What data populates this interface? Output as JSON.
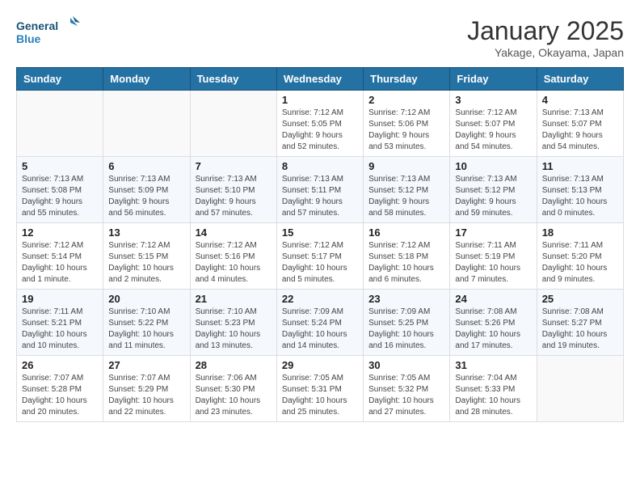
{
  "logo": {
    "line1": "General",
    "line2": "Blue"
  },
  "title": "January 2025",
  "subtitle": "Yakage, Okayama, Japan",
  "weekdays": [
    "Sunday",
    "Monday",
    "Tuesday",
    "Wednesday",
    "Thursday",
    "Friday",
    "Saturday"
  ],
  "weeks": [
    [
      {
        "day": "",
        "info": ""
      },
      {
        "day": "",
        "info": ""
      },
      {
        "day": "",
        "info": ""
      },
      {
        "day": "1",
        "info": "Sunrise: 7:12 AM\nSunset: 5:05 PM\nDaylight: 9 hours and 52 minutes."
      },
      {
        "day": "2",
        "info": "Sunrise: 7:12 AM\nSunset: 5:06 PM\nDaylight: 9 hours and 53 minutes."
      },
      {
        "day": "3",
        "info": "Sunrise: 7:12 AM\nSunset: 5:07 PM\nDaylight: 9 hours and 54 minutes."
      },
      {
        "day": "4",
        "info": "Sunrise: 7:13 AM\nSunset: 5:07 PM\nDaylight: 9 hours and 54 minutes."
      }
    ],
    [
      {
        "day": "5",
        "info": "Sunrise: 7:13 AM\nSunset: 5:08 PM\nDaylight: 9 hours and 55 minutes."
      },
      {
        "day": "6",
        "info": "Sunrise: 7:13 AM\nSunset: 5:09 PM\nDaylight: 9 hours and 56 minutes."
      },
      {
        "day": "7",
        "info": "Sunrise: 7:13 AM\nSunset: 5:10 PM\nDaylight: 9 hours and 57 minutes."
      },
      {
        "day": "8",
        "info": "Sunrise: 7:13 AM\nSunset: 5:11 PM\nDaylight: 9 hours and 57 minutes."
      },
      {
        "day": "9",
        "info": "Sunrise: 7:13 AM\nSunset: 5:12 PM\nDaylight: 9 hours and 58 minutes."
      },
      {
        "day": "10",
        "info": "Sunrise: 7:13 AM\nSunset: 5:12 PM\nDaylight: 9 hours and 59 minutes."
      },
      {
        "day": "11",
        "info": "Sunrise: 7:13 AM\nSunset: 5:13 PM\nDaylight: 10 hours and 0 minutes."
      }
    ],
    [
      {
        "day": "12",
        "info": "Sunrise: 7:12 AM\nSunset: 5:14 PM\nDaylight: 10 hours and 1 minute."
      },
      {
        "day": "13",
        "info": "Sunrise: 7:12 AM\nSunset: 5:15 PM\nDaylight: 10 hours and 2 minutes."
      },
      {
        "day": "14",
        "info": "Sunrise: 7:12 AM\nSunset: 5:16 PM\nDaylight: 10 hours and 4 minutes."
      },
      {
        "day": "15",
        "info": "Sunrise: 7:12 AM\nSunset: 5:17 PM\nDaylight: 10 hours and 5 minutes."
      },
      {
        "day": "16",
        "info": "Sunrise: 7:12 AM\nSunset: 5:18 PM\nDaylight: 10 hours and 6 minutes."
      },
      {
        "day": "17",
        "info": "Sunrise: 7:11 AM\nSunset: 5:19 PM\nDaylight: 10 hours and 7 minutes."
      },
      {
        "day": "18",
        "info": "Sunrise: 7:11 AM\nSunset: 5:20 PM\nDaylight: 10 hours and 9 minutes."
      }
    ],
    [
      {
        "day": "19",
        "info": "Sunrise: 7:11 AM\nSunset: 5:21 PM\nDaylight: 10 hours and 10 minutes."
      },
      {
        "day": "20",
        "info": "Sunrise: 7:10 AM\nSunset: 5:22 PM\nDaylight: 10 hours and 11 minutes."
      },
      {
        "day": "21",
        "info": "Sunrise: 7:10 AM\nSunset: 5:23 PM\nDaylight: 10 hours and 13 minutes."
      },
      {
        "day": "22",
        "info": "Sunrise: 7:09 AM\nSunset: 5:24 PM\nDaylight: 10 hours and 14 minutes."
      },
      {
        "day": "23",
        "info": "Sunrise: 7:09 AM\nSunset: 5:25 PM\nDaylight: 10 hours and 16 minutes."
      },
      {
        "day": "24",
        "info": "Sunrise: 7:08 AM\nSunset: 5:26 PM\nDaylight: 10 hours and 17 minutes."
      },
      {
        "day": "25",
        "info": "Sunrise: 7:08 AM\nSunset: 5:27 PM\nDaylight: 10 hours and 19 minutes."
      }
    ],
    [
      {
        "day": "26",
        "info": "Sunrise: 7:07 AM\nSunset: 5:28 PM\nDaylight: 10 hours and 20 minutes."
      },
      {
        "day": "27",
        "info": "Sunrise: 7:07 AM\nSunset: 5:29 PM\nDaylight: 10 hours and 22 minutes."
      },
      {
        "day": "28",
        "info": "Sunrise: 7:06 AM\nSunset: 5:30 PM\nDaylight: 10 hours and 23 minutes."
      },
      {
        "day": "29",
        "info": "Sunrise: 7:05 AM\nSunset: 5:31 PM\nDaylight: 10 hours and 25 minutes."
      },
      {
        "day": "30",
        "info": "Sunrise: 7:05 AM\nSunset: 5:32 PM\nDaylight: 10 hours and 27 minutes."
      },
      {
        "day": "31",
        "info": "Sunrise: 7:04 AM\nSunset: 5:33 PM\nDaylight: 10 hours and 28 minutes."
      },
      {
        "day": "",
        "info": ""
      }
    ]
  ]
}
